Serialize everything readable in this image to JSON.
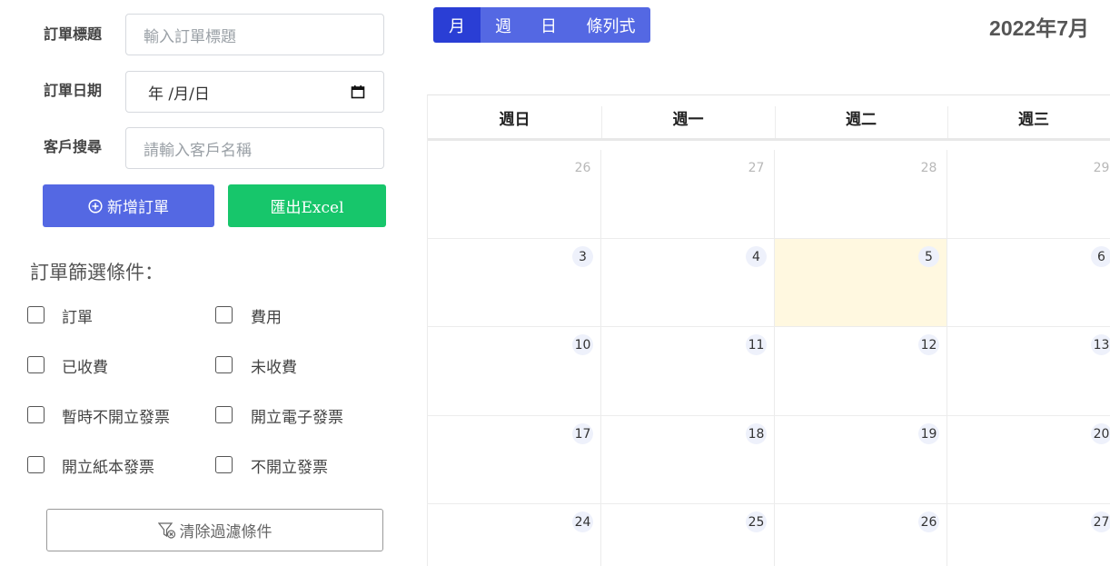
{
  "form": {
    "title_label": "訂單標題",
    "title_placeholder": "輸入訂單標題",
    "date_label": "訂單日期",
    "date_value": "年 /月/日",
    "customer_label": "客戶搜尋",
    "customer_placeholder": "請輸入客戶名稱"
  },
  "actions": {
    "add_label": "新增訂單",
    "export_label": "匯出Excel"
  },
  "filters": {
    "title": "訂單篩選條件：",
    "items": [
      "訂單",
      "費用",
      "已收費",
      "未收費",
      "暫時不開立發票",
      "開立電子發票",
      "開立紙本發票",
      "不開立發票"
    ],
    "clear_label": "清除過濾條件"
  },
  "calendar": {
    "views": [
      "月",
      "週",
      "日",
      "條列式"
    ],
    "active_view": "月",
    "title": "2022年7月",
    "weekdays": [
      "週日",
      "週一",
      "週二",
      "週三"
    ],
    "weeks": [
      [
        "26",
        "27",
        "28",
        "29"
      ],
      [
        "3",
        "4",
        "5",
        "6"
      ],
      [
        "10",
        "11",
        "12",
        "13"
      ],
      [
        "17",
        "18",
        "19",
        "20"
      ],
      [
        "24",
        "25",
        "26",
        "27"
      ]
    ],
    "today": "5",
    "colors": {
      "primary": "#5468e3",
      "active": "#2a3ed5",
      "success": "#17c66b",
      "today_bg": "#fff8e0"
    }
  }
}
